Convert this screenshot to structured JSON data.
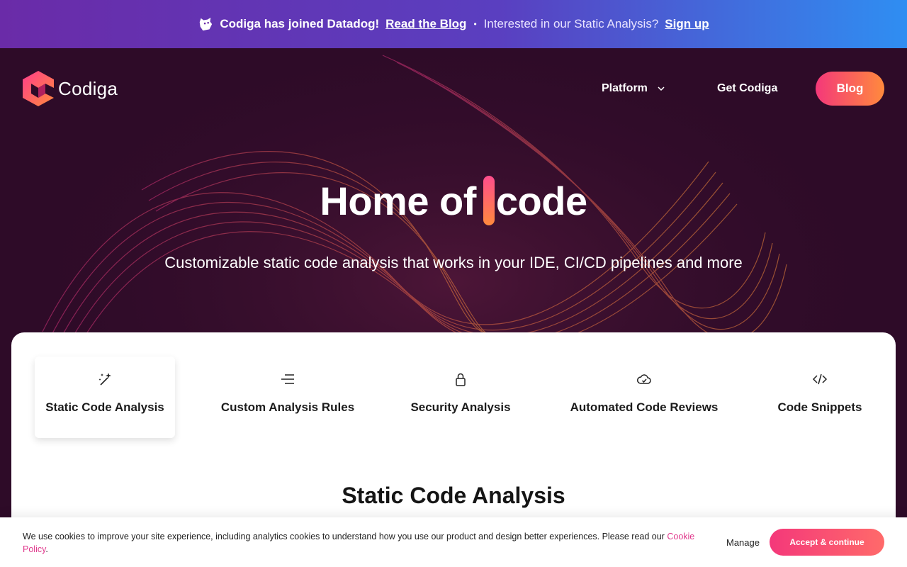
{
  "banner": {
    "lead": "Codiga has joined Datadog!",
    "blog_link": "Read the Blog",
    "separator": "•",
    "question": "Interested in our Static Analysis?",
    "signup_link": "Sign up"
  },
  "nav": {
    "logo_text": "Codiga",
    "platform": "Platform",
    "get": "Get Codiga",
    "blog": "Blog"
  },
  "hero": {
    "headline_prefix": "Home of",
    "headline_suffix": "code",
    "subline": "Customizable static code analysis that works in your IDE, CI/CD pipelines and more"
  },
  "tabs": [
    {
      "label": "Static Code Analysis",
      "icon": "magic-wand-icon",
      "active": true
    },
    {
      "label": "Custom Analysis Rules",
      "icon": "list-lines-icon",
      "active": false
    },
    {
      "label": "Security Analysis",
      "icon": "lock-icon",
      "active": false
    },
    {
      "label": "Automated Code Reviews",
      "icon": "cloud-check-icon",
      "active": false
    },
    {
      "label": "Code Snippets",
      "icon": "code-brackets-icon",
      "active": false
    }
  ],
  "section": {
    "title": "Static Code Analysis"
  },
  "cookie": {
    "message": "We use cookies to improve your site experience, including analytics cookies to understand how you use our product and design better experiences. Please read our",
    "policy_link": "Cookie Policy",
    "period": ".",
    "manage": "Manage",
    "accept": "Accept & continue"
  },
  "colors": {
    "banner_start": "#6a2ba8",
    "banner_end": "#2f8ef2",
    "hero_bg": "#2e0b28",
    "accent_pink": "#f4387a",
    "accent_orange": "#ff8a3d"
  }
}
